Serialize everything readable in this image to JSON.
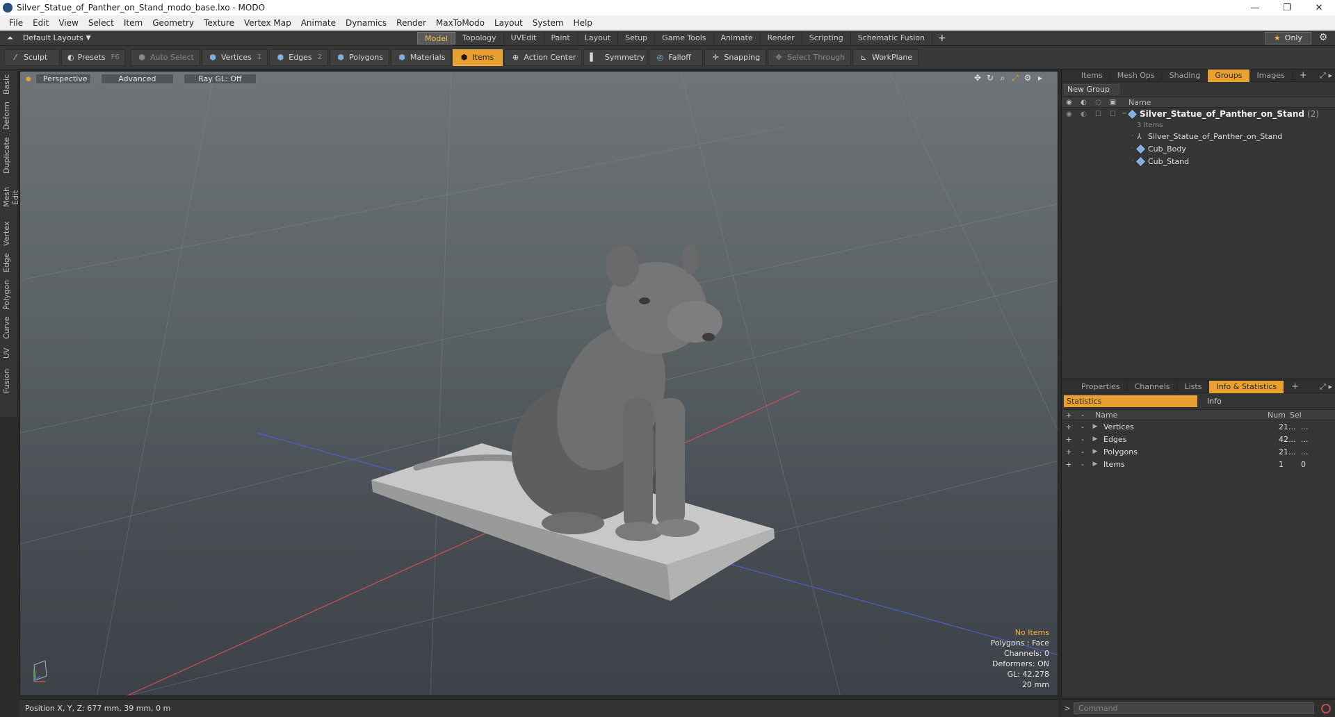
{
  "window": {
    "title": "Silver_Statue_of_Panther_on_Stand_modo_base.lxo - MODO",
    "minimize": "—",
    "maximize": "❐",
    "close": "✕"
  },
  "menu": [
    "File",
    "Edit",
    "View",
    "Select",
    "Item",
    "Geometry",
    "Texture",
    "Vertex Map",
    "Animate",
    "Dynamics",
    "Render",
    "MaxToModo",
    "Layout",
    "System",
    "Help"
  ],
  "layoutbar": {
    "layout_label": "Default Layouts",
    "tabs": [
      "Model",
      "Topology",
      "UVEdit",
      "Paint",
      "Layout",
      "Setup",
      "Game Tools",
      "Animate",
      "Render",
      "Scripting",
      "Schematic Fusion"
    ],
    "active_tab": "Model",
    "only_label": "Only"
  },
  "toolbar": {
    "sculpt": "Sculpt",
    "presets": "Presets",
    "presets_key": "F6",
    "auto_select": "Auto Select",
    "vertices": "Vertices",
    "vertices_key": "1",
    "edges": "Edges",
    "edges_key": "2",
    "polygons": "Polygons",
    "materials": "Materials",
    "items": "Items",
    "action_center": "Action Center",
    "symmetry": "Symmetry",
    "falloff": "Falloff",
    "snapping": "Snapping",
    "select_through": "Select Through",
    "workplane": "WorkPlane"
  },
  "left_tabs": [
    "Basic",
    "Deform",
    "Duplicate",
    "Mesh Edit",
    "Vertex",
    "Edge",
    "Polygon",
    "Curve",
    "UV",
    "Fusion"
  ],
  "viewport": {
    "view_mode": "Perspective",
    "shading": "Advanced",
    "raygl": "Ray GL: Off",
    "info": {
      "selection": "No Items",
      "polygons": "Polygons : Face",
      "channels": "Channels: 0",
      "deformers": "Deformers: ON",
      "gl": "GL: 42,278",
      "scale": "20 mm"
    }
  },
  "groups_panel": {
    "tabs": [
      "Items",
      "Mesh Ops",
      "Shading",
      "Groups",
      "Images"
    ],
    "active_tab": "Groups",
    "new_group": "New Group",
    "name_header": "Name",
    "group_name": "Silver_Statue_of_Panther_on_Stand",
    "group_count": "(2)",
    "group_items": "3 Items",
    "children": [
      "Silver_Statue_of_Panther_on_Stand",
      "Cub_Body",
      "Cub_Stand"
    ]
  },
  "stats_panel": {
    "tabs": [
      "Properties",
      "Channels",
      "Lists",
      "Info & Statistics"
    ],
    "active_tab": "Info & Statistics",
    "sub_tabs": [
      "Statistics",
      "Info"
    ],
    "headers": {
      "name": "Name",
      "num": "Num",
      "sel": "Sel"
    },
    "rows": [
      {
        "name": "Vertices",
        "num": "21...",
        "sel": "..."
      },
      {
        "name": "Edges",
        "num": "42...",
        "sel": "..."
      },
      {
        "name": "Polygons",
        "num": "21...",
        "sel": "..."
      },
      {
        "name": "Items",
        "num": "1",
        "sel": "0"
      }
    ]
  },
  "statusbar": {
    "position": "Position X, Y, Z:   677 mm, 39 mm, 0 m"
  },
  "command": {
    "placeholder": "Command"
  },
  "colors": {
    "accent": "#e8a030",
    "viewport_top": "#6e7478",
    "viewport_bottom": "#3c4247"
  }
}
